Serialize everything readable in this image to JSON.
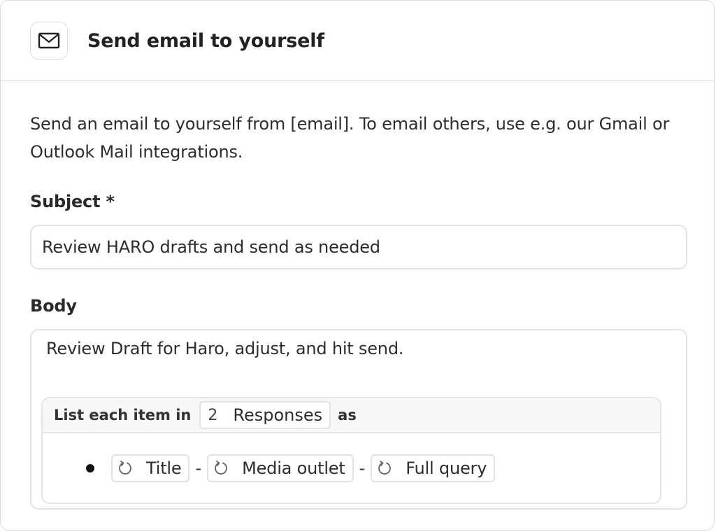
{
  "header": {
    "title": "Send email to yourself",
    "icon": "mail-icon"
  },
  "description": "Send an email to yourself from [email]. To email others, use e.g. our Gmail or Outlook Mail integrations.",
  "subject": {
    "label": "Subject *",
    "value": "Review HARO drafts and send as needed"
  },
  "body": {
    "label": "Body",
    "text": "Review Draft for Haro, adjust, and hit send.",
    "list": {
      "prefix": "List each item in",
      "count": "2",
      "source": "Responses",
      "suffix": "as",
      "separator": "-",
      "variables": [
        {
          "label": "Title",
          "icon": "loop-icon"
        },
        {
          "label": "Media outlet",
          "icon": "loop-icon"
        },
        {
          "label": "Full query",
          "icon": "loop-icon"
        }
      ]
    }
  }
}
